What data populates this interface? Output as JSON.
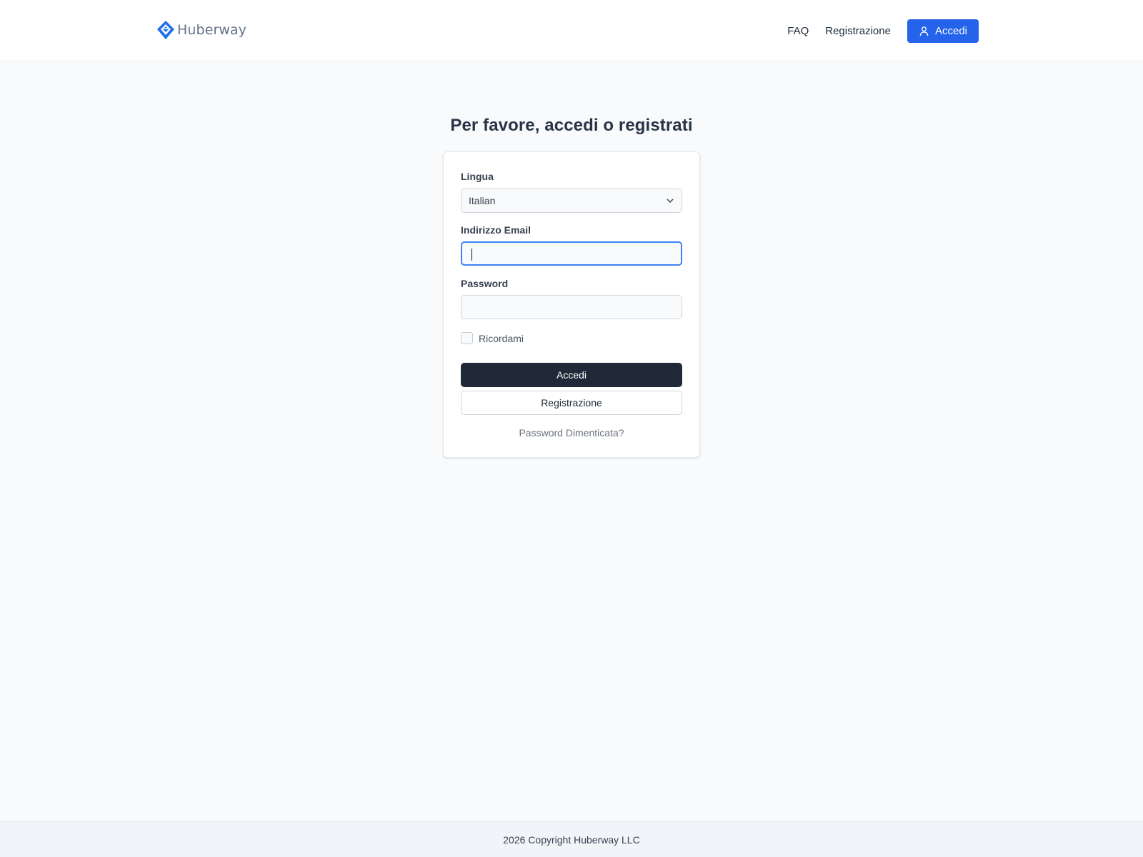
{
  "header": {
    "brand_name": "Huberway",
    "brand_icon": "huberway-logo-icon",
    "nav": {
      "faq": "FAQ",
      "register": "Registrazione",
      "login": "Accedi",
      "login_icon": "user-icon"
    }
  },
  "main": {
    "title": "Per favore, accedi o registrati"
  },
  "form": {
    "language_label": "Lingua",
    "language_value": "Italian",
    "language_icon": "chevron-down-icon",
    "email_label": "Indirizzo Email",
    "email_value": "",
    "password_label": "Password",
    "password_value": "",
    "remember_label": "Ricordami",
    "remember_checked": false,
    "login_button": "Accedi",
    "register_button": "Registrazione",
    "forgot_link": "Password Dimenticata?"
  },
  "footer": {
    "copyright": "2026 Copyright Huberway LLC"
  },
  "colors": {
    "accent": "#2563eb",
    "primary_button": "#1f2937",
    "focus_ring": "#3b82f6"
  }
}
